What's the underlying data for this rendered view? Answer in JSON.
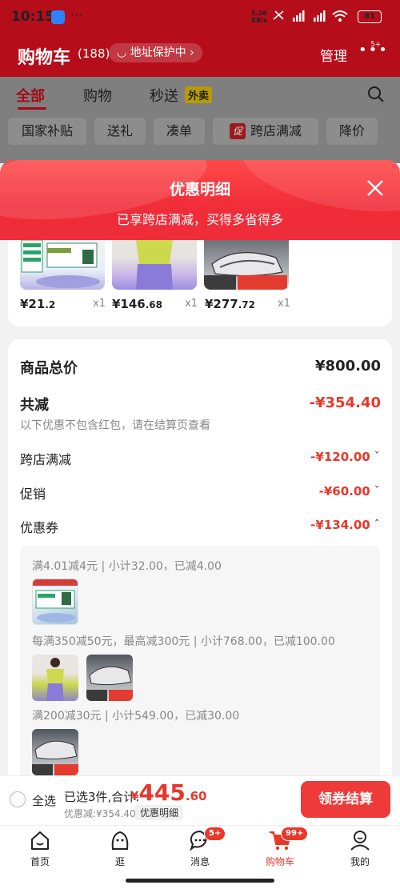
{
  "status_bar": {
    "time": "10:15",
    "speed_value": "5.26",
    "speed_unit": "KB/s",
    "battery": "81"
  },
  "header": {
    "title": "购物车",
    "count": "(188)",
    "address_protection": "地址保护中",
    "manage": "管理",
    "more_badge": "5+"
  },
  "tabs": [
    {
      "label": "全部"
    },
    {
      "label": "购物"
    },
    {
      "label": "秒送"
    }
  ],
  "tab_flash_badge": "外卖",
  "filters": [
    {
      "label": "国家补贴"
    },
    {
      "label": "送礼"
    },
    {
      "label": "凑单"
    },
    {
      "label": "跨店满减",
      "tag": "促"
    },
    {
      "label": "降价"
    }
  ],
  "sheet": {
    "title": "优惠明细",
    "subtitle": "已享跨店满减，买得多省得多"
  },
  "products": [
    {
      "price_main": "¥21",
      "price_cents": ".2",
      "qty": "x1"
    },
    {
      "price_main": "¥146",
      "price_cents": ".68",
      "qty": "x1"
    },
    {
      "price_main": "¥277",
      "price_cents": ".72",
      "qty": "x1"
    }
  ],
  "breakdown": {
    "total_label": "商品总价",
    "total_value": "¥800.00",
    "reduce_label": "共减",
    "reduce_value": "-¥354.40",
    "note": "以下优惠不包含红包，请在结算页查看",
    "rows": [
      {
        "label": "跨店满减",
        "value": "-¥120.00"
      },
      {
        "label": "促销",
        "value": "-¥60.00"
      },
      {
        "label": "优惠券",
        "value": "-¥134.00"
      }
    ]
  },
  "coupons": [
    "满4.01减4元 | 小计32.00，已减4.00",
    "每满350减50元，最高减300元 | 小计768.00，已减100.00",
    "满200减30元 | 小计549.00，已减30.00"
  ],
  "checkout": {
    "select_all": "全选",
    "selected_count": "已选3件,合计:",
    "currency": "¥",
    "total_big": "445",
    "total_cents": ".60",
    "saved": "优惠减:¥354.40",
    "detail_toggle": "优惠明细",
    "button": "领券结算"
  },
  "nav": [
    {
      "label": "首页"
    },
    {
      "label": "逛"
    },
    {
      "label": "消息",
      "badge": "5+"
    },
    {
      "label": "购物车",
      "badge": "99+"
    },
    {
      "label": "我的"
    }
  ],
  "colors": {
    "brand_red": "#e8382b",
    "sheet_header_red": "#f02c38",
    "checkout_button": "#ef3a3a"
  }
}
